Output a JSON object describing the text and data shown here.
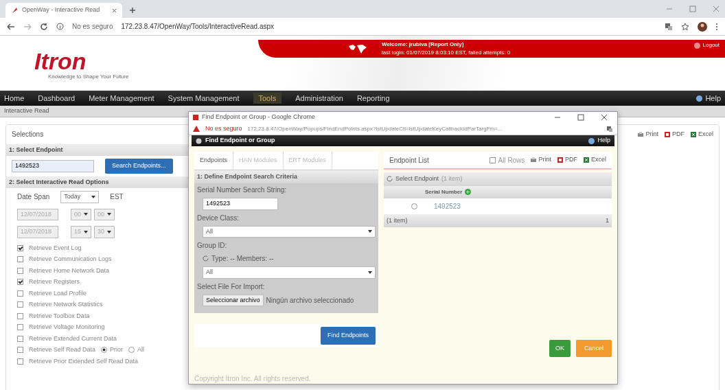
{
  "browser": {
    "tab_title": "OpenWay - Interactive Read",
    "security": "No es seguro",
    "url": "172.23.8.47/OpenWay/Tools/InteractiveRead.aspx"
  },
  "header": {
    "logo": "Itron",
    "tagline": "Knowledge to Shape Your Future",
    "welcome": "Welcome: jrubiva [Report Only]",
    "last_login": "last login: 01/07/2019 8:03:10 EST, failed attempts: 0",
    "logout": "Logout"
  },
  "nav": {
    "items": [
      {
        "label": "Home",
        "selected": false
      },
      {
        "label": "Dashboard",
        "selected": false
      },
      {
        "label": "Meter Management",
        "selected": false
      },
      {
        "label": "System Management",
        "selected": false
      },
      {
        "label": "Tools",
        "selected": true
      },
      {
        "label": "Administration",
        "selected": false
      },
      {
        "label": "Reporting",
        "selected": false
      }
    ],
    "help": "Help"
  },
  "breadcrumb": "Interactive Read",
  "selections": {
    "title": "Selections",
    "step1": "1: Select Endpoint",
    "endpoint": "1492523",
    "search_button": "Search Endpoints...",
    "step2": "2: Select Interactive Read Options",
    "date_span_label": "Date Span",
    "date_span": "Today",
    "timezone": "EST",
    "date_rows": [
      {
        "date": "12/07/2018",
        "hour": "00",
        "minute": "00"
      },
      {
        "date": "12/07/2018",
        "hour": "15",
        "minute": "30"
      }
    ],
    "options": [
      {
        "label": "Retrieve Event Log",
        "checked": true
      },
      {
        "label": "Retrieve Communication Logs",
        "checked": false
      },
      {
        "label": "Retrieve Home Network Data",
        "checked": false
      },
      {
        "label": "Retrieve Registers",
        "checked": true
      },
      {
        "label": "Retrieve Load Profile",
        "checked": false
      },
      {
        "label": "Retrieve Network Statistics",
        "checked": false
      },
      {
        "label": "Retrieve Toolbox Data",
        "checked": false
      },
      {
        "label": "Retrieve Voltage Monitoring",
        "checked": false
      },
      {
        "label": "Retrieve Extended Current Data",
        "checked": false
      },
      {
        "label": "Retrieve Self Read Data",
        "checked": false,
        "choices": [
          {
            "label": "Prior",
            "selected": true
          },
          {
            "label": "All",
            "selected": false
          }
        ]
      },
      {
        "label": "Retrieve Prior Extended Self Read Data",
        "checked": false
      }
    ],
    "exports": [
      "Print",
      "PDF",
      "Excel"
    ]
  },
  "popup": {
    "title": "Find Endpoint or Group - Google Chrome",
    "security": "No es seguro",
    "url": "172.23.8.47/OpenWay/Popups/FindEndPoints.aspx?lstUpdateCtl=lstUpdateKeyCallbackIdParTargFm=...",
    "header": "Find Endpoint or Group",
    "help": "Help",
    "tabs": [
      {
        "label": "Endpoints",
        "selected": true
      },
      {
        "label": "HAN Modules",
        "selected": false
      },
      {
        "label": "ERT Modules",
        "selected": false
      }
    ],
    "criteria_title": "1: Define Endpoint Search Criteria",
    "serial_label": "Serial Number Search String:",
    "serial": "1492523",
    "device_class_label": "Device Class:",
    "device_class": "All",
    "group_label": "Group ID:",
    "group_type": "Type: -- Members: --",
    "group": "All",
    "file_label": "Select File For Import:",
    "file_button": "Seleccionar archivo",
    "file_status": "Ningún archivo seleccionado",
    "find_button": "Find Endpoints",
    "list": {
      "title": "Endpoint List",
      "all_rows": "All Rows",
      "all_rows_checked": false,
      "exports": [
        "Print",
        "PDF",
        "Excel"
      ],
      "caption": "Select Endpoint",
      "caption_count": "(1 item)",
      "column": "Serial Number",
      "rows": [
        {
          "serial": "1492523",
          "selected": false
        }
      ],
      "footer": "(1 item)",
      "page": "1"
    },
    "ok": "OK",
    "cancel": "Cancel",
    "status": "Copyright Itron Inc. All rights reserved."
  }
}
